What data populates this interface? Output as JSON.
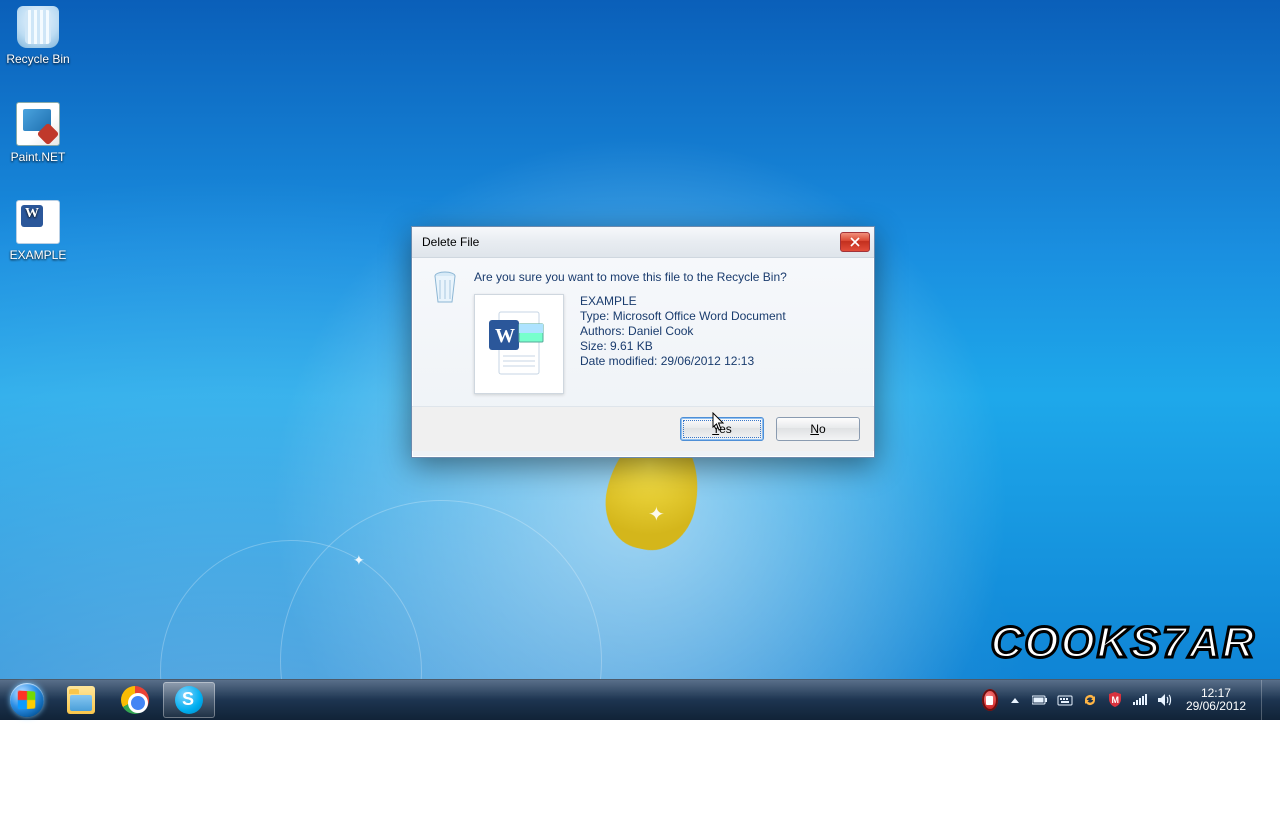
{
  "desktop": {
    "icons": {
      "recycle_bin": "Recycle Bin",
      "paintnet": "Paint.NET",
      "example": "EXAMPLE"
    }
  },
  "dialog": {
    "title": "Delete File",
    "message": "Are you sure you want to move this file to the Recycle Bin?",
    "file": {
      "name": "EXAMPLE",
      "type_label": "Type:",
      "type_value": "Microsoft Office Word Document",
      "authors_label": "Authors:",
      "authors_value": "Daniel Cook",
      "size_label": "Size:",
      "size_value": "9.61 KB",
      "modified_label": "Date modified:",
      "modified_value": "29/06/2012 12:13"
    },
    "buttons": {
      "yes_key": "Y",
      "yes_rest": "es",
      "no_key": "N",
      "no_rest": "o"
    },
    "close_tooltip": "Close"
  },
  "taskbar": {
    "start_tooltip": "Start",
    "explorer_tooltip": "Windows Explorer",
    "chrome_tooltip": "Google Chrome",
    "skype_tooltip": "Skype"
  },
  "tray": {
    "time": "12:17",
    "date": "29/06/2012"
  },
  "watermark": "COOKS7AR"
}
